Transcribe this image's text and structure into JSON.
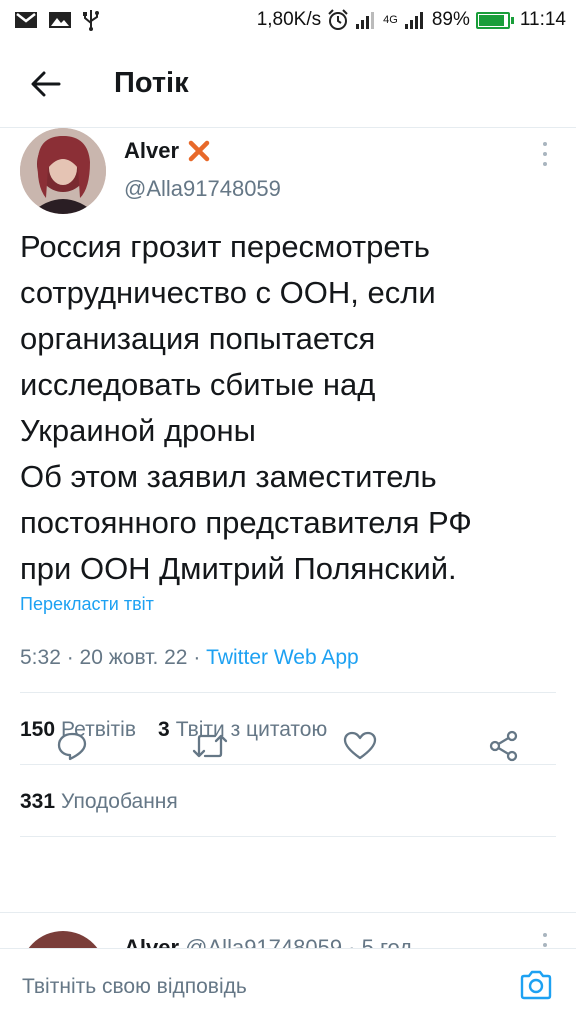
{
  "status_bar": {
    "speed": "1,80K/s",
    "network": "4G",
    "battery": "89%",
    "battery_level": 0.89,
    "time": "11:14",
    "icons": [
      "gmail-icon",
      "image-icon",
      "usb-icon",
      "alarm-icon",
      "signal-icon",
      "signal-4g-icon",
      "battery-icon"
    ]
  },
  "header": {
    "title": "Потік",
    "back_icon": "arrow-left-icon"
  },
  "tweet": {
    "display_name": "Alver",
    "badge_icon": "x-mark-icon",
    "handle": "@Alla91748059",
    "text_lines": [
      "Россия грозит пересмотреть",
      "сотрудничество с ООН, если",
      "организация попытается",
      "исследовать сбитые над",
      "Украиной дроны",
      "Об этом заявил заместитель",
      "постоянного представителя РФ",
      "при ООН Дмитрий Полянский."
    ],
    "translate_label": "Перекласти твіт",
    "time": "5:32",
    "date": "20 жовт. 22",
    "source": "Twitter Web App",
    "retweets_count": "150",
    "retweets_label": "Ретвітів",
    "quotes_count": "3",
    "quotes_label": "Твіти з цитатою",
    "likes_count": "331",
    "likes_label": "Уподобання"
  },
  "actions": {
    "reply_icon": "reply-icon",
    "retweet_icon": "retweet-icon",
    "like_icon": "heart-icon",
    "share_icon": "share-icon"
  },
  "next_tweet": {
    "display_name": "Alver",
    "handle_time": "@Alla91748059 · 5 год"
  },
  "reply_bar": {
    "placeholder": "Твітніть свою відповідь",
    "camera_icon": "camera-icon"
  },
  "colors": {
    "accent": "#1da1f2",
    "text": "#14171a",
    "secondary": "#657786",
    "badge": "#e8692a",
    "battery": "#1a9e3a"
  }
}
